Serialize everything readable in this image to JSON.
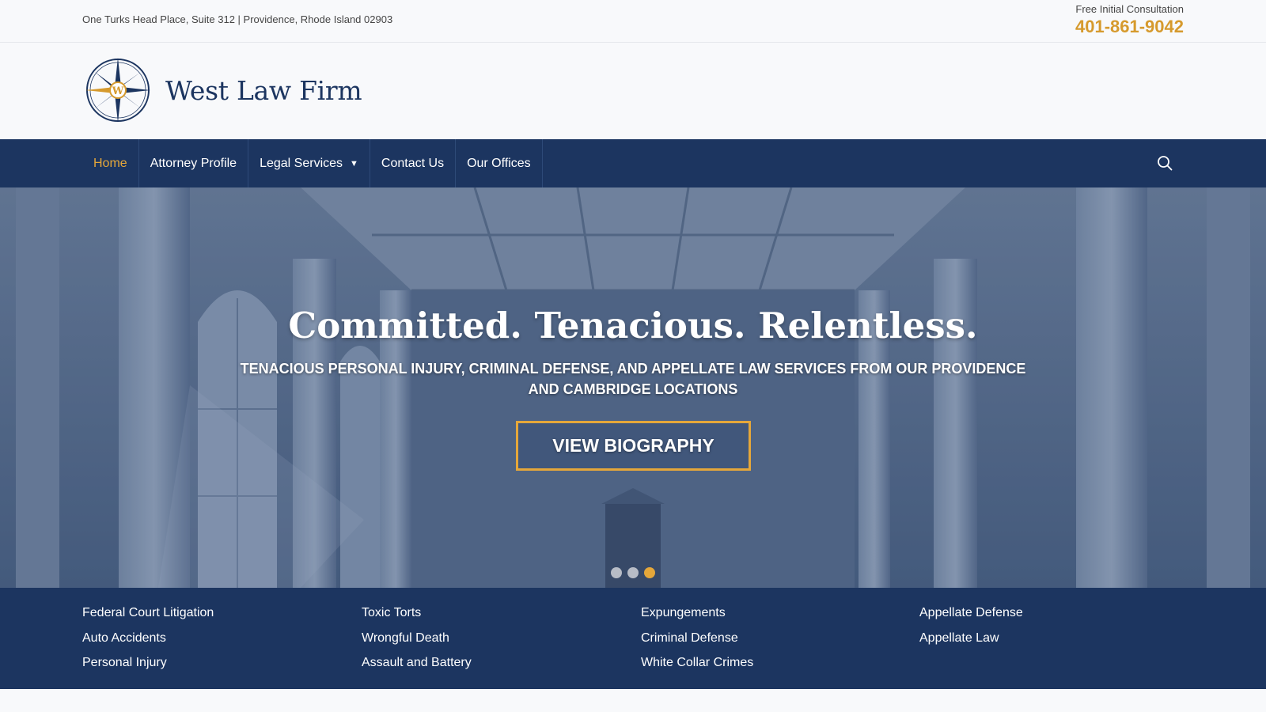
{
  "topbar": {
    "address": "One Turks Head Place, Suite 312 | Providence, Rhode Island 02903",
    "consult_label": "Free Initial Consultation",
    "phone": "401-861-9042"
  },
  "brand": {
    "name": "West Law Firm",
    "logo_letter": "W"
  },
  "nav": {
    "items": [
      {
        "label": "Home"
      },
      {
        "label": "Attorney Profile"
      },
      {
        "label": "Legal Services"
      },
      {
        "label": "Contact Us"
      },
      {
        "label": "Our Offices"
      }
    ],
    "dropdown_icon": "▼",
    "search_icon": "search-icon"
  },
  "hero": {
    "title": "Committed. Tenacious. Relentless.",
    "subtitle": "TENACIOUS PERSONAL INJURY, CRIMINAL DEFENSE, AND APPELLATE LAW SERVICES FROM OUR PROVIDENCE AND CAMBRIDGE LOCATIONS",
    "button": "VIEW BIOGRAPHY",
    "slides": 3,
    "active_slide": 3
  },
  "practice_areas": {
    "columns": [
      [
        "Federal Court Litigation",
        "Auto Accidents",
        "Personal Injury"
      ],
      [
        "Toxic Torts",
        "Wrongful Death",
        "Assault and Battery"
      ],
      [
        "Expungements",
        "Criminal Defense",
        "White Collar Crimes"
      ],
      [
        "Appellate Defense",
        "Appellate Law"
      ]
    ]
  },
  "colors": {
    "navy": "#1c3560",
    "gold": "#e5a73a",
    "phone": "#d69a2d"
  }
}
